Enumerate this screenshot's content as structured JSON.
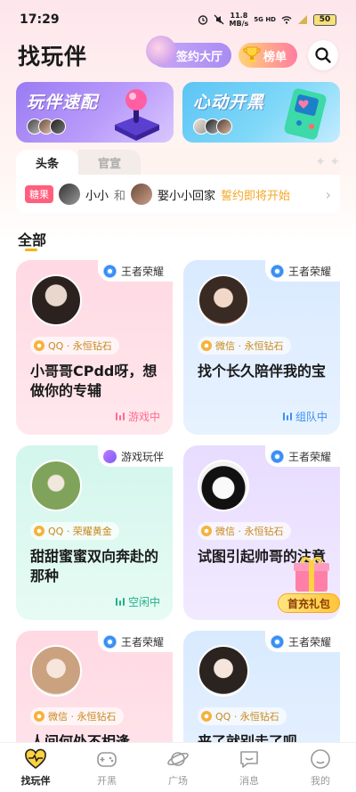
{
  "status_bar": {
    "time": "17:29",
    "net_speed_value": "11.8",
    "net_speed_unit": "MB/s",
    "network_type": "5G HD",
    "battery_level": "50"
  },
  "header": {
    "title": "找玩伴",
    "contract_hall_label": "签约大厅",
    "leaderboard_label": "榜单"
  },
  "banners": [
    {
      "title": "玩伴速配"
    },
    {
      "title": "心动开黑"
    }
  ],
  "news": {
    "tabs": [
      "头条",
      "官宣"
    ],
    "active_tab": "头条",
    "tag": "糖果",
    "user_a": "小小",
    "connector": "和",
    "user_b": "娶小小回家",
    "message": "誓约即将开始"
  },
  "section": {
    "title": "全部"
  },
  "cards": [
    {
      "game": "王者荣耀",
      "rank": "QQ · 永恒钻石",
      "text": "小哥哥CPdd呀，想做你的专辅",
      "status": "游戏中",
      "theme": "pink"
    },
    {
      "game": "王者荣耀",
      "rank": "微信 · 永恒钻石",
      "text": "找个长久陪伴我的宝",
      "status": "组队中",
      "theme": "blue"
    },
    {
      "game": "游戏玩伴",
      "rank": "QQ · 荣耀黄金",
      "text": "甜甜蜜蜜双向奔赴的那种",
      "status": "空闲中",
      "theme": "mint"
    },
    {
      "game": "王者荣耀",
      "rank": "微信 · 永恒钻石",
      "text": "试图引起帅哥的注意",
      "status": "",
      "theme": "purple"
    },
    {
      "game": "王者荣耀",
      "rank": "微信 · 永恒钻石",
      "text": "人间何处不相逢",
      "status": "",
      "theme": "pink"
    },
    {
      "game": "王者荣耀",
      "rank": "QQ · 永恒钻石",
      "text": "来了就别走了呗",
      "status": "",
      "theme": "blue"
    }
  ],
  "gift": {
    "label": "首充礼包"
  },
  "tab_bar": {
    "items": [
      "找玩伴",
      "开黑",
      "广场",
      "消息",
      "我的"
    ],
    "active": "找玩伴"
  },
  "colors": {
    "accent_gold": "#f5b400",
    "candy_red": "#ff5f7d",
    "status_pink": "#ff6b8f",
    "status_blue": "#3b8ff0",
    "status_green": "#22b08a"
  }
}
